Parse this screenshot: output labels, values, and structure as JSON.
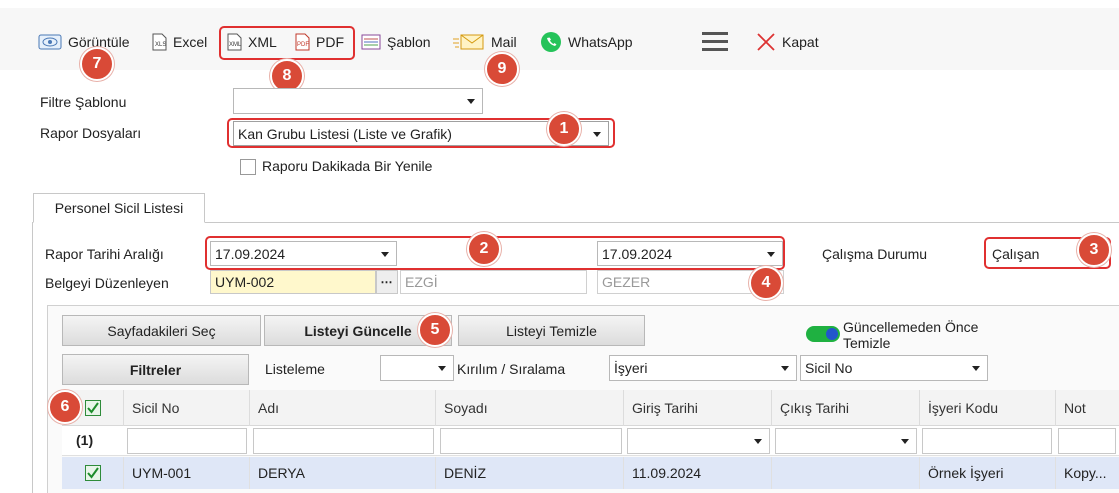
{
  "toolbar": {
    "view_label": "Görüntüle",
    "excel_label": "Excel",
    "xml_label": "XML",
    "pdf_label": "PDF",
    "template_label": "Şablon",
    "mail_label": "Mail",
    "whatsapp_label": "WhatsApp",
    "close_label": "Kapat"
  },
  "badges": {
    "b1": "1",
    "b2": "2",
    "b3": "3",
    "b4": "4",
    "b5": "5",
    "b6": "6",
    "b7": "7",
    "b8": "8",
    "b9": "9"
  },
  "filter": {
    "template_label": "Filtre Şablonu",
    "template_value": "",
    "report_files_label": "Rapor Dosyaları",
    "report_files_value": "Kan Grubu Listesi (Liste ve Grafik)",
    "refresh_label": "Raporu Dakikada Bir Yenile"
  },
  "tab": {
    "label": "Personel Sicil Listesi"
  },
  "form": {
    "date_range_label": "Rapor Tarihi Aralığı",
    "date_start": "17.09.2024",
    "date_end": "17.09.2024",
    "work_status_label": "Çalışma Durumu",
    "work_status_value": "Çalışan",
    "issuer_label": "Belgeyi Düzenleyen",
    "issuer_code": "UYM-002",
    "issuer_first": "EZGİ",
    "issuer_last": "GEZER"
  },
  "buttons": {
    "select_page": "Sayfadakileri Seç",
    "update_list": "Listeyi Güncelle",
    "clear_list": "Listeyi Temizle",
    "toggle_label": "Güncellemeden Önce Temizle",
    "filters": "Filtreler",
    "listing_label": "Listeleme",
    "listing_value": "",
    "grouping_label": "Kırılım / Sıralama",
    "grouping_value": "İşyeri",
    "sort_value": "Sicil No"
  },
  "grid": {
    "headers": [
      "Sicil No",
      "Adı",
      "Soyadı",
      "Giriş Tarihi",
      "Çıkış Tarihi",
      "İşyeri Kodu",
      "Not"
    ],
    "count_label": "(1)",
    "rows": [
      {
        "sicil": "UYM-001",
        "adi": "DERYA",
        "soyadi": "DENİZ",
        "giris": "11.09.2024",
        "cikis": "",
        "isyeri": "Örnek İşyeri",
        "not": "Kopy..."
      }
    ]
  },
  "colors": {
    "accent_red": "#e03030",
    "badge": "#d94a37",
    "toggle": "#1fb141",
    "row_selected": "#dfe7f7"
  }
}
